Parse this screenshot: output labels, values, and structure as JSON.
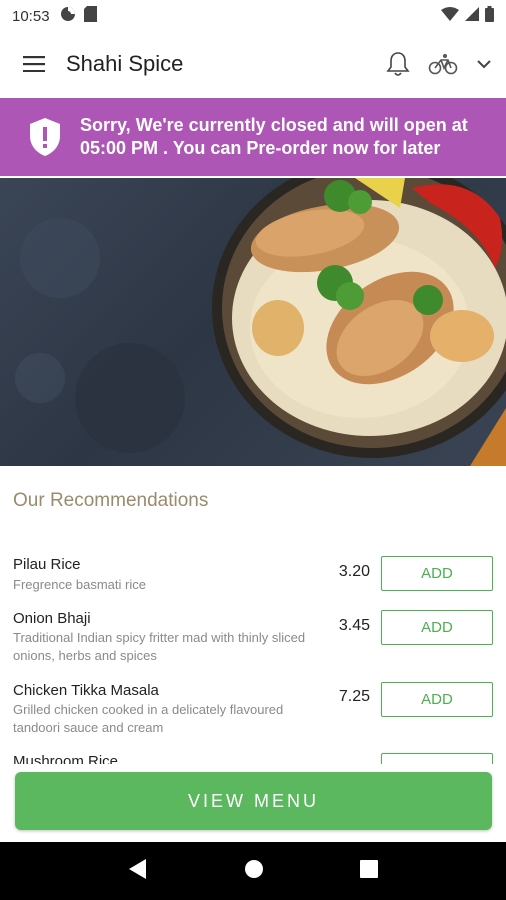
{
  "status_bar": {
    "time": "10:53",
    "icons": [
      "data-saver-icon",
      "sd-card-icon",
      "wifi-icon",
      "signal-icon",
      "battery-icon"
    ]
  },
  "app_bar": {
    "title": "Shahi Spice",
    "icons": [
      "hamburger-menu-icon",
      "bell-icon",
      "cycling-icon",
      "chevron-down-icon"
    ]
  },
  "banner": {
    "message": "Sorry, We're currently closed and will open at 05:00 PM . You can Pre-order now for later",
    "color": "#ad56b6"
  },
  "recommendations": {
    "title": "Our Recommendations",
    "items": [
      {
        "name": "Pilau Rice",
        "description": "Fregrence basmati rice",
        "price": "3.20",
        "button": "ADD"
      },
      {
        "name": "Onion Bhaji",
        "description": "Traditional Indian spicy fritter mad with thinly sliced onions, herbs and spices",
        "price": "3.45",
        "button": "ADD"
      },
      {
        "name": "Chicken Tikka Masala",
        "description": "Grilled chicken cooked in a delicately flavoured tandoori sauce and cream",
        "price": "7.25",
        "button": "ADD"
      },
      {
        "name": "Mushroom Rice",
        "description": "",
        "price": "",
        "button": "ADD"
      }
    ]
  },
  "view_menu": {
    "label": "VIEW MENU",
    "color": "#5cb85f"
  },
  "nav_bar": {
    "icons": [
      "back-icon",
      "home-icon",
      "recents-icon"
    ]
  },
  "colors": {
    "accent_green": "#4caf50",
    "section_title": "#9a8a6e"
  }
}
